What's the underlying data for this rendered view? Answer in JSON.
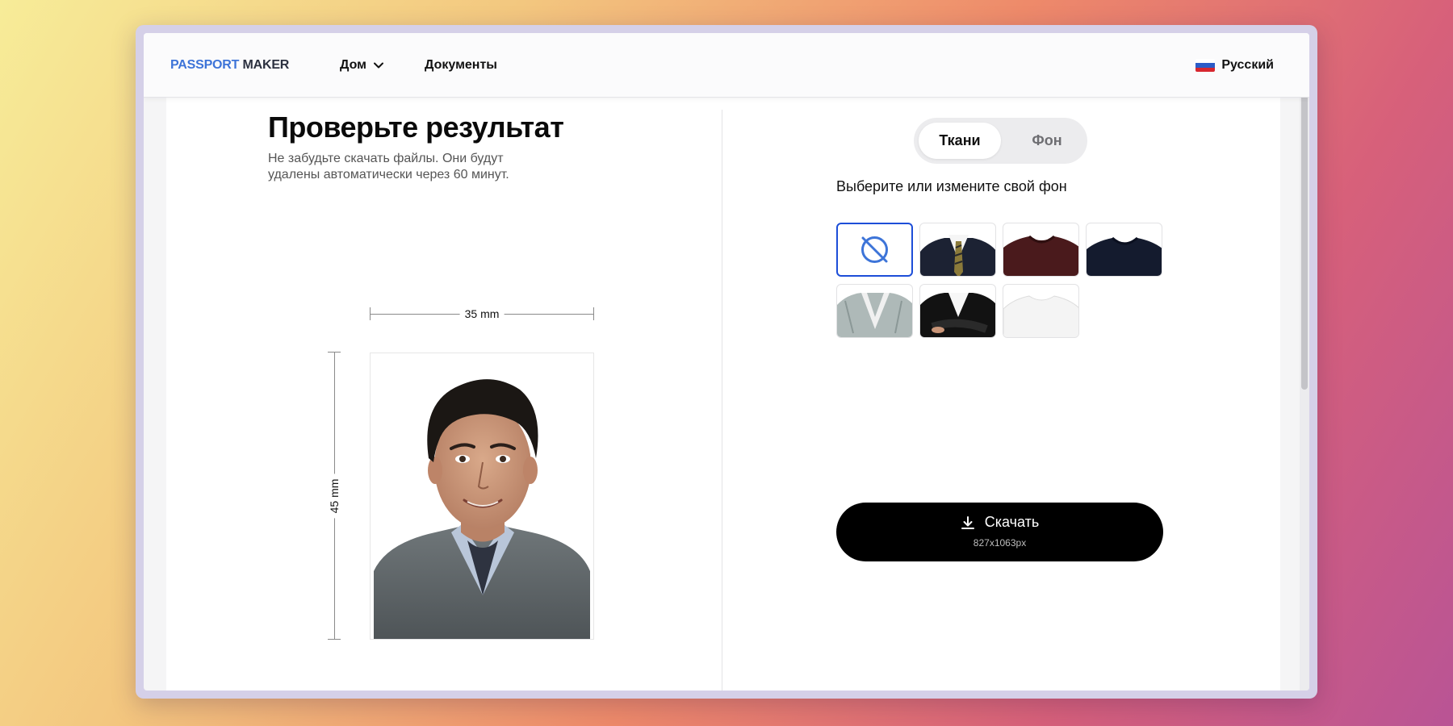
{
  "brand": {
    "logo_part1": "PASSPORT",
    "logo_part2": "MAKER"
  },
  "nav": {
    "home_label": "Дом",
    "docs_label": "Документы",
    "language": "Русский"
  },
  "result": {
    "title": "Проверьте результат",
    "subtitle": "Не забудьте скачать файлы. Они будут удалены автоматически через 60 минут.",
    "width_label": "35 mm",
    "height_label": "45 mm"
  },
  "tabs": {
    "clothes": "Ткани",
    "background": "Фон",
    "active": "clothes"
  },
  "clothes_panel": {
    "heading": "Выберите или измените свой фон",
    "options": [
      {
        "name": "none",
        "selected": true
      },
      {
        "name": "dark-suit-tie"
      },
      {
        "name": "burgundy-sweater"
      },
      {
        "name": "navy-sweater"
      },
      {
        "name": "tweed-jacket"
      },
      {
        "name": "black-blazer-arms-crossed"
      },
      {
        "name": "white-tshirt"
      }
    ]
  },
  "download": {
    "label": "Скачать",
    "size": "827x1063px"
  },
  "colors": {
    "accent": "#1d4ed8",
    "logo_blue": "#3d74d8",
    "button_bg": "#000000"
  }
}
